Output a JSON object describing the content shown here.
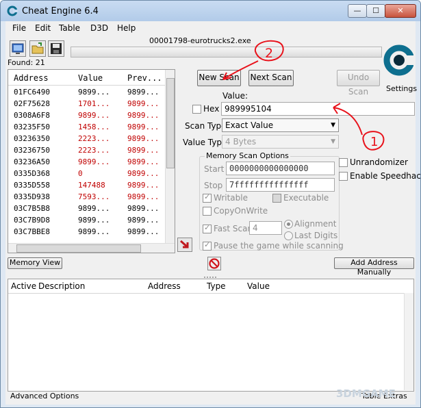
{
  "window": {
    "title": "Cheat Engine 6.4",
    "controls": {
      "minimize": "—",
      "maximize": "☐",
      "close": "✕"
    }
  },
  "menu": [
    "File",
    "Edit",
    "Table",
    "D3D",
    "Help"
  ],
  "toolbar": {
    "icons": [
      "open-process-icon",
      "open-file-icon",
      "save-icon"
    ]
  },
  "process": "00001798-eurotrucks2.exe",
  "found": "Found: 21",
  "settings_label": "Settings",
  "results": {
    "headers": [
      "Address",
      "Value",
      "Prev..."
    ],
    "rows": [
      {
        "address": "01FC6490",
        "value": "9899...",
        "prev": "9899...",
        "changed": false
      },
      {
        "address": "02F75628",
        "value": "1701...",
        "prev": "9899...",
        "changed": true
      },
      {
        "address": "0308A6F8",
        "value": "9899...",
        "prev": "9899...",
        "changed": true
      },
      {
        "address": "03235F50",
        "value": "1458...",
        "prev": "9899...",
        "changed": true
      },
      {
        "address": "03236350",
        "value": "2223...",
        "prev": "9899...",
        "changed": true
      },
      {
        "address": "03236750",
        "value": "2223...",
        "prev": "9899...",
        "changed": true
      },
      {
        "address": "03236A50",
        "value": "9899...",
        "prev": "9899...",
        "changed": true
      },
      {
        "address": "0335D368",
        "value": "0",
        "prev": "9899...",
        "changed": true
      },
      {
        "address": "0335D558",
        "value": "147488",
        "prev": "9899...",
        "changed": true
      },
      {
        "address": "0335D938",
        "value": "7593...",
        "prev": "9899...",
        "changed": true
      },
      {
        "address": "03C7B5B8",
        "value": "9899...",
        "prev": "9899...",
        "changed": false
      },
      {
        "address": "03C7B9D8",
        "value": "9899...",
        "prev": "9899...",
        "changed": false
      },
      {
        "address": "03C7BBE8",
        "value": "9899...",
        "prev": "9899...",
        "changed": false
      }
    ]
  },
  "scan": {
    "new_scan": "New Scan",
    "next_scan": "Next Scan",
    "undo_scan": "Undo Scan",
    "value_label": "Value:",
    "hex_label": "Hex",
    "value": "989995104",
    "scan_type_label": "Scan Type",
    "scan_type": "Exact Value",
    "value_type_label": "Value Type",
    "value_type": "4 Bytes"
  },
  "memory_options": {
    "title": "Memory Scan Options",
    "start_label": "Start",
    "start": "0000000000000000",
    "stop_label": "Stop",
    "stop": "7fffffffffffffff",
    "writable": "Writable",
    "executable": "Executable",
    "copy_on_write": "CopyOnWrite",
    "fast_scan": "Fast Scan",
    "fast_scan_value": "4",
    "alignment": "Alignment",
    "last_digits": "Last Digits",
    "pause": "Pause the game while scanning"
  },
  "extras": {
    "unrandomizer": "Unrandomizer",
    "speedhack": "Enable Speedhack"
  },
  "memory_view": "Memory View",
  "add_address": "Add Address Manually",
  "address_table": {
    "headers": [
      "Active",
      "Description",
      "Address",
      "Type",
      "Value"
    ]
  },
  "footer": {
    "advanced": "Advanced Options",
    "extras": "Table Extras"
  },
  "annotations": {
    "two": "2",
    "one": "1"
  },
  "watermark": "3DMGAME",
  "colors": {
    "changed_value": "#c00000",
    "annotation": "#e8121b",
    "logo": "#0e6f8f"
  }
}
